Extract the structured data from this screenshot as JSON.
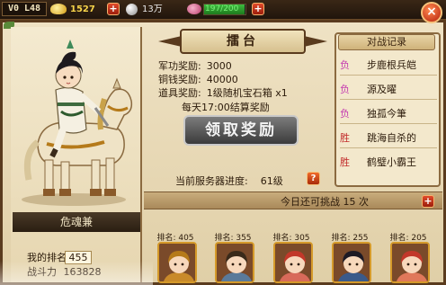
{
  "topbar": {
    "level": "V0 L48",
    "gold": "1527",
    "silver": "13万",
    "stamina": "197/200",
    "stamina_fraction": 0.985,
    "gold_icon": "gold-ingot-icon",
    "silver_icon": "silver-coin-icon",
    "stamina_icon": "stamina-meat-icon",
    "plus_label": "+",
    "close_label": "×"
  },
  "hero": {
    "name": "危魂兼",
    "rank_label": "我的排名",
    "rank_value": "455",
    "power_label": "战斗力",
    "power_value": "163828"
  },
  "arena": {
    "title": "擂台",
    "rewards": [
      {
        "label": "军功奖励:",
        "value": "3000"
      },
      {
        "label": "铜钱奖励:",
        "value": "40000"
      },
      {
        "label": "道具奖励:",
        "value": "1级随机宝石箱 x1"
      }
    ],
    "daily_note": "每天17:00结算奖励",
    "claim_button": "领取奖励",
    "server_progress_label": "当前服务器进度:",
    "server_progress_value": "61级",
    "help_label": "?"
  },
  "record": {
    "title": "对战记录",
    "entries": [
      {
        "result": "负",
        "name": "步鹿根兵皑"
      },
      {
        "result": "负",
        "name": "源及曜"
      },
      {
        "result": "负",
        "name": "独孤今筆"
      },
      {
        "result": "胜",
        "name": "跳海自杀的"
      },
      {
        "result": "胜",
        "name": "鹤璧小霸王"
      }
    ]
  },
  "challenge": {
    "text": "今日还可挑战 15 次",
    "plus_label": "+"
  },
  "opponents": [
    {
      "rank": "排名: 405",
      "hair": "#b57a1a",
      "outfit": "#c98a2a"
    },
    {
      "rank": "排名: 355",
      "hair": "#3a2a1a",
      "outfit": "#5a7a9a"
    },
    {
      "rank": "排名: 305",
      "hair": "#c2382a",
      "outfit": "#d86a5a"
    },
    {
      "rank": "排名: 255",
      "hair": "#1e1a24",
      "outfit": "#3a5a8a"
    },
    {
      "rank": "排名: 205",
      "hair": "#c2382a",
      "outfit": "#e0785a"
    }
  ],
  "colors": {
    "loss": "#c43ab0",
    "win": "#c22c2c",
    "frame": "#5a3b1e",
    "parchment": "#efe2c4"
  }
}
